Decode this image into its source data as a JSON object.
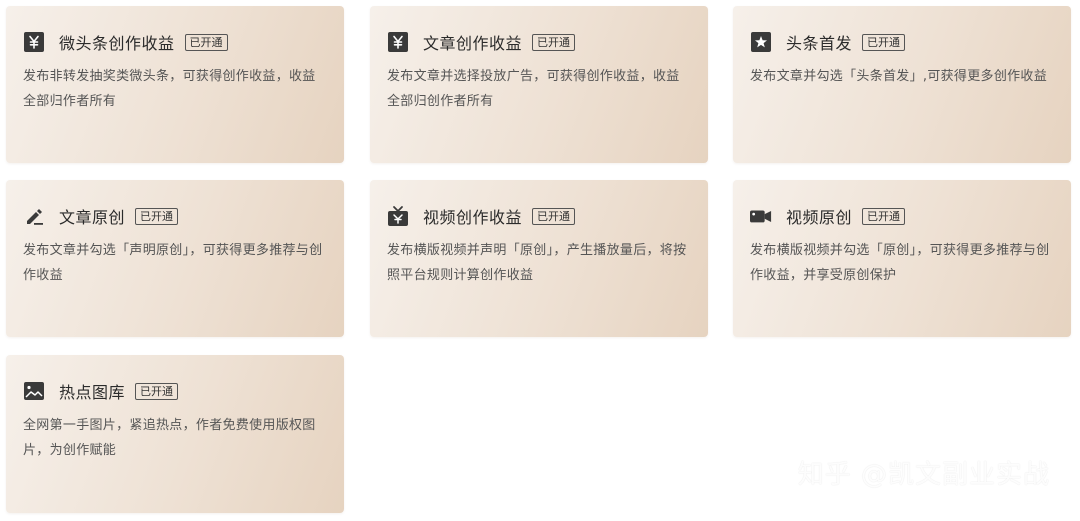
{
  "cards": [
    {
      "title": "微头条创作收益",
      "badge": "已开通",
      "icon": "yen-icon",
      "description": "发布非转发抽奖类微头条，可获得创作收益，收益全部归作者所有"
    },
    {
      "title": "文章创作收益",
      "badge": "已开通",
      "icon": "yen-icon",
      "description": "发布文章并选择投放广告，可获得创作收益，收益全部归创作者所有"
    },
    {
      "title": "头条首发",
      "badge": "已开通",
      "icon": "star-icon",
      "description": "发布文章并勾选「头条首发」,可获得更多创作收益"
    },
    {
      "title": "文章原创",
      "badge": "已开通",
      "icon": "pen-icon",
      "description": "发布文章并勾选「声明原创」，可获得更多推荐与创作收益"
    },
    {
      "title": "视频创作收益",
      "badge": "已开通",
      "icon": "tv-icon",
      "description": "发布横版视频并声明「原创」，产生播放量后，将按照平台规则计算创作收益"
    },
    {
      "title": "视频原创",
      "badge": "已开通",
      "icon": "video-camera-icon",
      "description": "发布横版视频并勾选「原创」，可获得更多推荐与创作收益，并享受原创保护"
    },
    {
      "title": "热点图库",
      "badge": "已开通",
      "icon": "image-icon",
      "description": "全网第一手图片，紧追热点，作者免费使用版权图片，为创作赋能"
    }
  ],
  "watermark": "知乎 @凯文副业实战",
  "colors": {
    "icon": "#3a3a3a",
    "card_start": "#f6f0ea",
    "card_end": "#e6d3c0"
  }
}
